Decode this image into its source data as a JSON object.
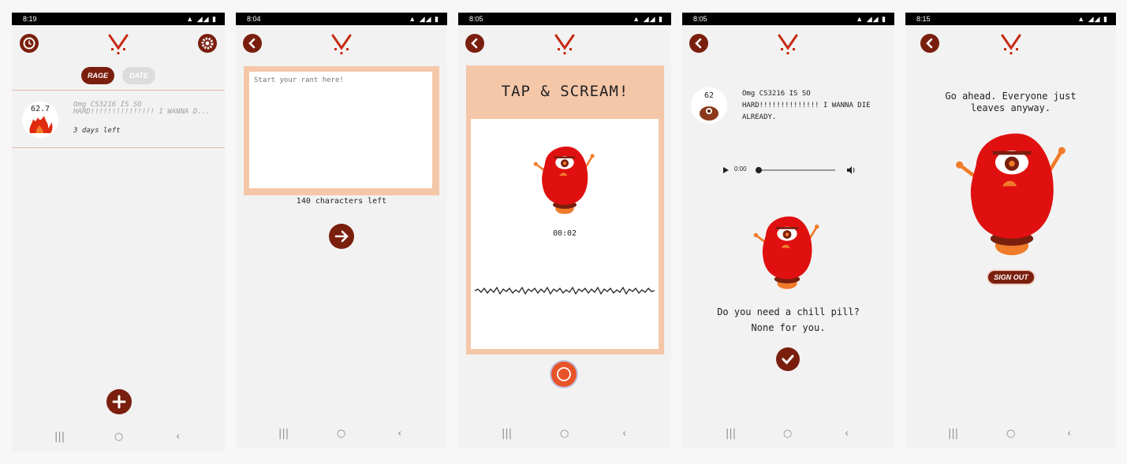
{
  "colors": {
    "accent": "#7a1f0e",
    "peach": "#f5c7a9",
    "monster_red": "#e01010",
    "monster_orange": "#f07b2a"
  },
  "screens": [
    {
      "status": {
        "time": "8:19",
        "icons": "▲ ◢◢ ▮"
      },
      "tabs": {
        "rage": "RAGE",
        "date": "DATE"
      },
      "rant": {
        "score": "62.7",
        "text": "Omg CS3216 IS SO HARD!!!!!!!!!!!!!!! I WANNA D...",
        "expiry": "3 days left"
      },
      "icons": {
        "history": "clock-icon",
        "settings": "gear-icon",
        "add": "plus-icon"
      }
    },
    {
      "status": {
        "time": "8:04",
        "icons": "▲ ◢◢ ▮"
      },
      "input": {
        "placeholder": "Start your rant here!"
      },
      "char_count": "140 characters left",
      "icons": {
        "back": "chevron-left-icon",
        "next": "arrow-right-icon"
      }
    },
    {
      "status": {
        "time": "8:05",
        "icons": "▲ ◢◢ ▮"
      },
      "header": "TAP & SCREAM!",
      "timer": "00:02",
      "icons": {
        "back": "chevron-left-icon",
        "record": "record-icon"
      }
    },
    {
      "status": {
        "time": "8:05",
        "icons": "▲ ◢◢ ▮"
      },
      "rant": {
        "score": "62",
        "text": "Omg CS3216 IS SO HARD!!!!!!!!!!!!!! I WANNA DIE ALREADY."
      },
      "audio": {
        "time": "0:00"
      },
      "message_line1": "Do you need a chill pill?",
      "message_line2": "None for you.",
      "icons": {
        "back": "chevron-left-icon",
        "confirm": "check-icon"
      }
    },
    {
      "status": {
        "time": "8:15",
        "icons": "▲ ◢◢ ▮"
      },
      "message_line1": "Go ahead. Everyone just",
      "message_line2": "leaves anyway.",
      "signout_label": "SIGN OUT",
      "icons": {
        "back": "chevron-left-icon"
      }
    }
  ],
  "nav": {
    "recents": "|||",
    "home": "○",
    "back": "‹"
  }
}
